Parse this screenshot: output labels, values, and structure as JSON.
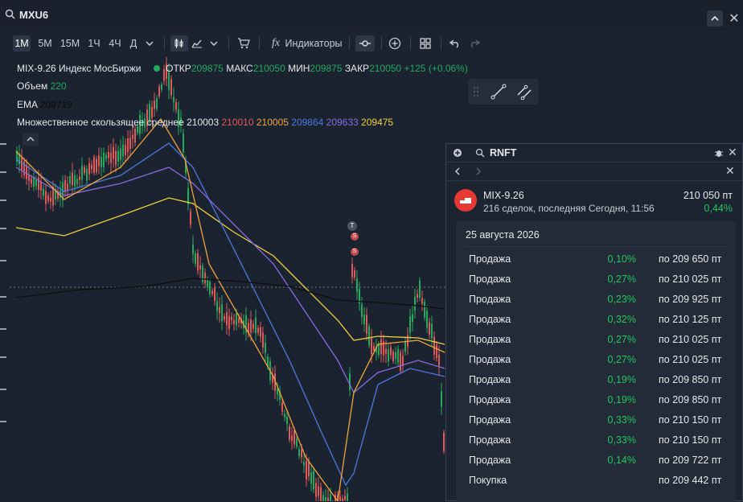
{
  "search": {
    "symbol": "MXU6"
  },
  "toolbar": {
    "timeframes": [
      "1М",
      "5М",
      "15М",
      "1Ч",
      "4Ч",
      "Д"
    ],
    "indicators_label": "Индикаторы"
  },
  "legend": {
    "title": "MIX-9.26 Индекс МосБиржи",
    "open_label": "ОТКР",
    "open": "209875",
    "high_label": "МАКС",
    "high": "210050",
    "low_label": "МИН",
    "low": "209875",
    "close_label": "ЗАКР",
    "close": "210050",
    "change": "+125 (+0.06%)",
    "volume_label": "Объем",
    "volume": "220",
    "ema_label": "EMA",
    "ema": "209719",
    "ma_label": "Множественное скользящее среднее",
    "ma_values": [
      "210003",
      "210010",
      "210005",
      "209864",
      "209633",
      "209475"
    ]
  },
  "chart_markers": {
    "t": "T",
    "s": "S"
  },
  "panel": {
    "search_value": "RNFT",
    "instrument": "MIX-9.26",
    "subtitle": "216 сделок, последняя Сегодня, 11:56",
    "price": "210 050 пт",
    "change": "0,44%",
    "date": "25 августа 2026",
    "trades": [
      {
        "side": "Продажа",
        "pct": "0,10%",
        "price": "по 209 650 пт"
      },
      {
        "side": "Продажа",
        "pct": "0,27%",
        "price": "по 210 025 пт"
      },
      {
        "side": "Продажа",
        "pct": "0,23%",
        "price": "по 209 925 пт"
      },
      {
        "side": "Продажа",
        "pct": "0,32%",
        "price": "по 210 125 пт"
      },
      {
        "side": "Продажа",
        "pct": "0,27%",
        "price": "по 210 025 пт"
      },
      {
        "side": "Продажа",
        "pct": "0,27%",
        "price": "по 210 025 пт"
      },
      {
        "side": "Продажа",
        "pct": "0,19%",
        "price": "по 209 850 пт"
      },
      {
        "side": "Продажа",
        "pct": "0,19%",
        "price": "по 209 850 пт"
      },
      {
        "side": "Продажа",
        "pct": "0,33%",
        "price": "по 210 150 пт"
      },
      {
        "side": "Продажа",
        "pct": "0,33%",
        "price": "по 210 150 пт"
      },
      {
        "side": "Продажа",
        "pct": "0,14%",
        "price": "по 209 722 пт"
      },
      {
        "side": "Покупка",
        "pct": "",
        "price": "по 209 442 пт"
      }
    ]
  },
  "colors": {
    "up": "#22ab5c",
    "down": "#e05a5a",
    "accent": "#2962ff"
  }
}
